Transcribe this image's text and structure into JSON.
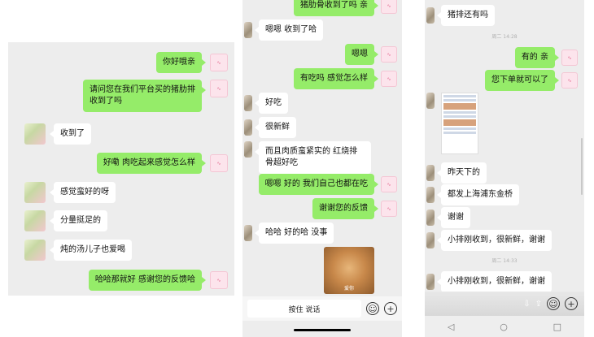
{
  "panel1": {
    "messages": [
      {
        "side": "me",
        "text": "你好哦亲"
      },
      {
        "side": "me",
        "text": "请问您在我们平台买的猪肋排收到了吗"
      },
      {
        "side": "them",
        "text": "收到了"
      },
      {
        "side": "me",
        "text": "好嘞 肉吃起来感觉怎么样"
      },
      {
        "side": "them",
        "text": "感觉蛮好的呀"
      },
      {
        "side": "them",
        "text": "分量挺足的"
      },
      {
        "side": "them",
        "text": "炖的汤儿子也爱喝"
      },
      {
        "side": "me",
        "text": "哈哈那就好 感谢您的反馈哈"
      }
    ]
  },
  "panel2": {
    "messages": [
      {
        "side": "me",
        "text": "猪肋骨收到了吗 亲"
      },
      {
        "side": "them",
        "text": "嗯嗯 收到了哈"
      },
      {
        "side": "me",
        "text": "嗯嗯"
      },
      {
        "side": "me",
        "text": "有吃吗 感觉怎么样"
      },
      {
        "side": "them",
        "text": "好吃"
      },
      {
        "side": "them",
        "text": "很新鲜"
      },
      {
        "side": "them",
        "text": "而且肉质蛮紧实的 红烧排骨超好吃"
      },
      {
        "side": "me",
        "text": "嗯嗯 好的 我们自己也都在吃"
      },
      {
        "side": "me",
        "text": "谢谢您的反馈"
      },
      {
        "side": "them",
        "text": "哈哈 好的哈 没事"
      }
    ],
    "sticker_caption": "爱你",
    "input_bar": {
      "hold_to_talk": "按住 说话"
    }
  },
  "panel3": {
    "messages": [
      {
        "side": "them",
        "text": "猪排还有吗"
      },
      {
        "side": "me",
        "text": "有的 亲"
      },
      {
        "side": "me",
        "text": "您下单就可以了"
      },
      {
        "side": "them",
        "text": "昨天下的"
      },
      {
        "side": "them",
        "text": "都发上海浦东金桥"
      },
      {
        "side": "them",
        "text": "谢谢"
      },
      {
        "side": "them",
        "text": "小排刚收到，很新鲜，谢谢"
      },
      {
        "side": "them",
        "text": "小排刚收到，很新鲜，谢谢"
      }
    ],
    "timestamps": [
      "周二 14:28",
      "周二 14:33"
    ]
  },
  "icons": {
    "me_avatar": "pink-logo-avatar",
    "emoji": "emoji-icon",
    "plus": "plus-icon"
  }
}
